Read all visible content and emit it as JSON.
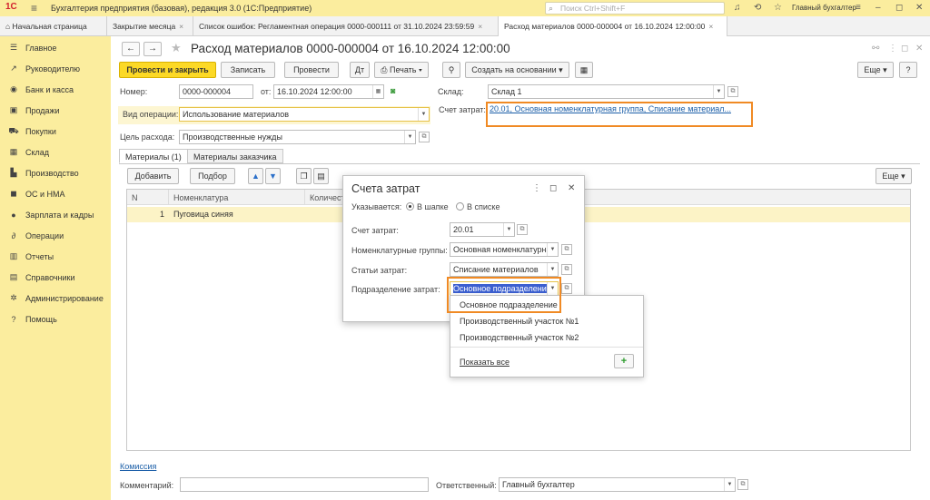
{
  "titlebar": {
    "logo": "1С",
    "title": "Бухгалтерия предприятия (базовая), редакция 3.0  (1С:Предприятие)",
    "search_placeholder": "Поиск Ctrl+Shift+F",
    "user": "Главный бухгалтер"
  },
  "tabs": [
    {
      "label": "Начальная страница",
      "closable": false
    },
    {
      "label": "Закрытие месяца",
      "closable": true
    },
    {
      "label": "Список ошибок: Регламентная операция 0000-000111 от 31.10.2024 23:59:59",
      "closable": true
    },
    {
      "label": "Расход материалов 0000-000004 от 16.10.2024 12:00:00",
      "closable": true
    }
  ],
  "sidebar": {
    "items": [
      {
        "label": "Главное",
        "icon": "menu-icon"
      },
      {
        "label": "Руководителю",
        "icon": "chart-line-icon"
      },
      {
        "label": "Банк и касса",
        "icon": "bank-icon"
      },
      {
        "label": "Продажи",
        "icon": "bag-icon"
      },
      {
        "label": "Покупки",
        "icon": "cart-icon"
      },
      {
        "label": "Склад",
        "icon": "warehouse-icon"
      },
      {
        "label": "Производство",
        "icon": "factory-icon"
      },
      {
        "label": "ОС и НМА",
        "icon": "truck-icon"
      },
      {
        "label": "Зарплата и кадры",
        "icon": "person-icon"
      },
      {
        "label": "Операции",
        "icon": "operations-icon"
      },
      {
        "label": "Отчеты",
        "icon": "reports-icon"
      },
      {
        "label": "Справочники",
        "icon": "books-icon"
      },
      {
        "label": "Администрирование",
        "icon": "gear-icon"
      },
      {
        "label": "Помощь",
        "icon": "help-icon"
      }
    ]
  },
  "form": {
    "title": "Расход материалов 0000-000004 от 16.10.2024 12:00:00",
    "toolbar": {
      "post_close": "Провести и закрыть",
      "save": "Записать",
      "post": "Провести",
      "print": "Печать",
      "create_based": "Создать на основании",
      "more": "Еще",
      "help": "?"
    },
    "fields": {
      "number_label": "Номер:",
      "number_value": "0000-000004",
      "date_label": "от:",
      "date_value": "16.10.2024 12:00:00",
      "warehouse_label": "Склад:",
      "warehouse_value": "Склад 1",
      "op_type_label": "Вид операции:",
      "op_type_value": "Использование материалов",
      "cost_account_label": "Счет затрат:",
      "cost_account_value": "20.01, Основная номенклатурная группа, Списание материал...",
      "purpose_label": "Цель расхода:",
      "purpose_value": "Производственные нужды"
    },
    "subtabs": [
      "Материалы (1)",
      "Материалы заказчика"
    ],
    "table_toolbar": {
      "add": "Добавить",
      "pick": "Подбор",
      "more": "Еще"
    },
    "table": {
      "columns": [
        "N",
        "Номенклатура",
        "Количест"
      ],
      "rows": [
        {
          "n": "1",
          "item": "Пуговица синяя"
        }
      ]
    },
    "commission_link": "Комиссия",
    "comment_label": "Комментарий:",
    "comment_value": "",
    "responsible_label": "Ответственный:",
    "responsible_value": "Главный бухгалтер"
  },
  "dialog": {
    "title": "Счета затрат",
    "specified_label": "Указывается:",
    "opt_header": "В шапке",
    "opt_list": "В списке",
    "account_label": "Счет затрат:",
    "account_value": "20.01",
    "groups_label": "Номенклатурные группы:",
    "groups_value": "Основная номенклатурная группа",
    "items_label": "Статьи затрат:",
    "items_value": "Списание материалов",
    "dept_label": "Подразделение затрат:",
    "dept_value": "Основное подразделение"
  },
  "dropdown": {
    "options": [
      "Основное подразделение",
      "Производственный участок №1",
      "Производственный участок №2"
    ],
    "show_all": "Показать все",
    "add": "+"
  },
  "colors": {
    "sidebar_bg": "#fbed9e",
    "primary_button": "#fcd926",
    "highlight_frame": "#f08a24",
    "link": "#1c5fa8",
    "selected_text_bg": "#3b5fd0"
  }
}
